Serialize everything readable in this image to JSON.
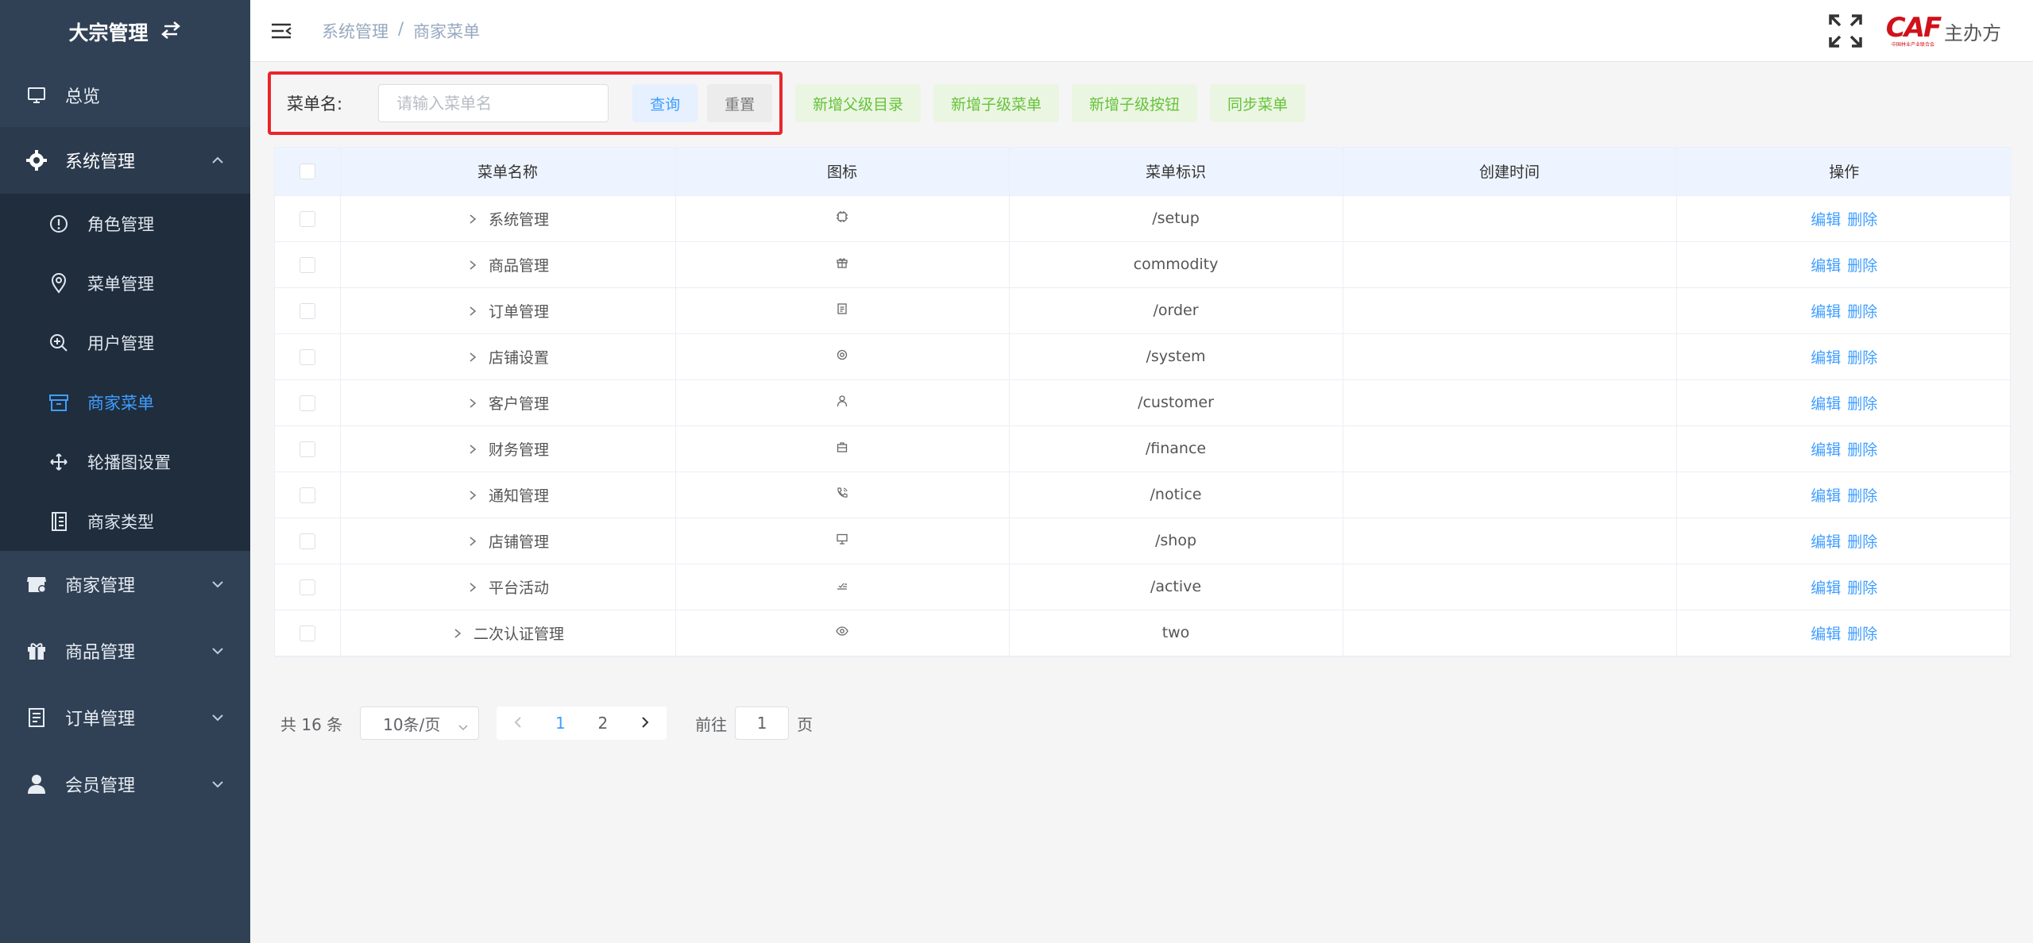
{
  "sidebar": {
    "brand": "大宗管理",
    "items": [
      {
        "label": "总览"
      },
      {
        "label": "系统管理"
      },
      {
        "label": "商家管理"
      },
      {
        "label": "商品管理"
      },
      {
        "label": "订单管理"
      },
      {
        "label": "会员管理"
      }
    ],
    "submenu": [
      {
        "label": "角色管理"
      },
      {
        "label": "菜单管理"
      },
      {
        "label": "用户管理"
      },
      {
        "label": "商家菜单"
      },
      {
        "label": "轮播图设置"
      },
      {
        "label": "商家类型"
      }
    ],
    "active_color": "#409eff"
  },
  "header": {
    "breadcrumb": [
      "系统管理",
      "商家菜单"
    ],
    "breadcrumb_sep": "/",
    "logo_text": "CAF",
    "logo_sub": "中国林业产业联合会",
    "organizer": "主办方"
  },
  "toolbar": {
    "search_label": "菜单名:",
    "search_placeholder": "请输入菜单名",
    "query": "查询",
    "reset": "重置",
    "add_parent": "新增父级目录",
    "add_child_menu": "新增子级菜单",
    "add_child_button": "新增子级按钮",
    "sync_menu": "同步菜单"
  },
  "table": {
    "headers": [
      "菜单名称",
      "图标",
      "菜单标识",
      "创建时间",
      "操作"
    ],
    "rows": [
      {
        "name": "系统管理",
        "icon": "chip-icon",
        "key": "/setup",
        "created": ""
      },
      {
        "name": "商品管理",
        "icon": "gift-icon",
        "key": "commodity",
        "created": ""
      },
      {
        "name": "订单管理",
        "icon": "document-icon",
        "key": "/order",
        "created": ""
      },
      {
        "name": "店铺设置",
        "icon": "settings-icon",
        "key": "/system",
        "created": ""
      },
      {
        "name": "客户管理",
        "icon": "user-icon",
        "key": "/customer",
        "created": ""
      },
      {
        "name": "财务管理",
        "icon": "suitcase-icon",
        "key": "/finance",
        "created": ""
      },
      {
        "name": "通知管理",
        "icon": "phone-icon",
        "key": "/notice",
        "created": ""
      },
      {
        "name": "店铺管理",
        "icon": "monitor-icon",
        "key": "/shop",
        "created": ""
      },
      {
        "name": "平台活动",
        "icon": "checklist-icon",
        "key": "/active",
        "created": ""
      },
      {
        "name": "二次认证管理",
        "icon": "eye-icon",
        "key": "two",
        "created": ""
      }
    ],
    "edit": "编辑",
    "delete": "删除",
    "header_bg": "#eef4ff"
  },
  "pagination": {
    "total": "共 16 条",
    "page_size": "10条/页",
    "pages": [
      "1",
      "2"
    ],
    "current": "1",
    "goto_label": "前往",
    "goto_value": "1",
    "page_suffix": "页"
  }
}
